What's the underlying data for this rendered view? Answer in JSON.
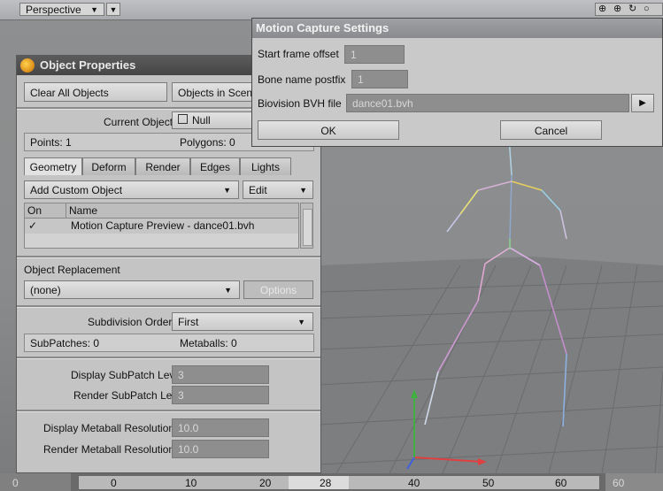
{
  "viewport": {
    "view_mode": "Perspective",
    "colors": {
      "bg": "#8b8d8e",
      "grid": "#6c6e70"
    }
  },
  "object_properties": {
    "title": "Object Properties",
    "clear_all": "Clear All Objects",
    "objects_in_scene": "Objects in Scen",
    "current_object_label": "Current Object",
    "current_object_value": "Null",
    "points": "Points: 1",
    "polygons": "Polygons: 0",
    "tabs": [
      "Geometry",
      "Deform",
      "Render",
      "Edges",
      "Lights"
    ],
    "add_custom_object": "Add Custom Object",
    "edit": "Edit",
    "list_headers": {
      "on": "On",
      "name": "Name"
    },
    "list_items": [
      {
        "on": "✓",
        "name": "Motion Capture Preview - dance01.bvh"
      }
    ],
    "object_replacement_label": "Object Replacement",
    "replacement_value": "(none)",
    "options": "Options",
    "subdivision_order_label": "Subdivision Order",
    "subdivision_order_value": "First",
    "subpatches": "SubPatches: 0",
    "metaballs": "Metaballs: 0",
    "display_subpatch_label": "Display SubPatch Level",
    "display_subpatch_value": "3",
    "render_subpatch_label": "Render SubPatch Level",
    "render_subpatch_value": "3",
    "display_metaball_label": "Display Metaball Resolution",
    "display_metaball_value": "10.0",
    "render_metaball_label": "Render Metaball Resolution",
    "render_metaball_value": "10.0"
  },
  "motion_capture": {
    "title": "Motion Capture Settings",
    "start_frame_label": "Start frame offset",
    "start_frame_value": "1",
    "bone_postfix_label": "Bone name postfix",
    "bone_postfix_value": "1",
    "bvh_file_label": "Biovision BVH file",
    "bvh_file_value": "dance01.bvh",
    "ok": "OK",
    "cancel": "Cancel"
  },
  "timeline": {
    "start": "0",
    "end": "60",
    "current_frame": "28",
    "ticks": [
      "0",
      "10",
      "20",
      "28",
      "40",
      "50",
      "60"
    ]
  }
}
